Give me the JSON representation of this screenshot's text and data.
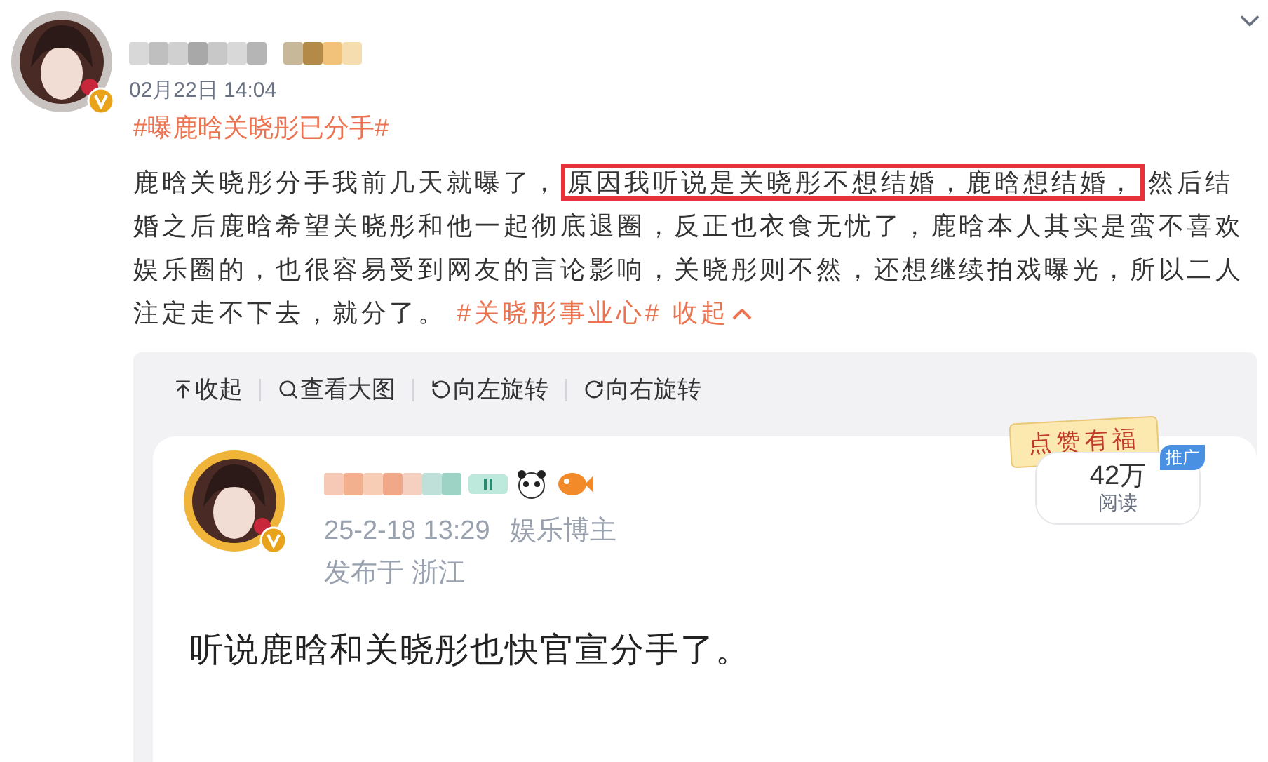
{
  "post": {
    "date": "02月22日 14:04",
    "topic": "#曝鹿晗关晓彤已分手#",
    "text_before": "鹿晗关晓彤分手我前几天就曝了，",
    "text_highlight": "原因我听说是关晓彤不想结婚，鹿晗想结婚，",
    "text_after": "然后结婚之后鹿晗希望关晓彤和他一起彻底退圈，反正也衣食无忧了，鹿晗本人其实是蛮不喜欢娱乐圈的，也很容易受到网友的言论影响，关晓彤则不然，还想继续拍戏曝光，所以二人注定走不下去，就分了。",
    "tag": "#关晓彤事业心#",
    "collapse": "收起"
  },
  "image_toolbar": [
    {
      "kind": "collapse",
      "label": "收起"
    },
    {
      "kind": "zoom",
      "label": "查看大图"
    },
    {
      "kind": "rotate_left",
      "label": "向左旋转"
    },
    {
      "kind": "rotate_right",
      "label": "向右旋转"
    }
  ],
  "embedded": {
    "time": "25-2-18 13:29",
    "role": "娱乐博主",
    "location": "发布于 浙江",
    "banner": "点赞有福",
    "reads": "42万",
    "reads_label": "阅读",
    "promo": "推广",
    "text": "听说鹿晗和关晓彤也快官宣分手了。"
  }
}
